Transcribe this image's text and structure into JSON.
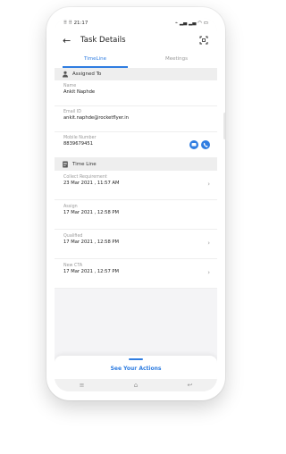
{
  "status_bar": {
    "time": "21:17",
    "left_icons": "⠿ ⠿",
    "right_icons": "⌁ ▂▄ ▂▄ ◠ ▭"
  },
  "header": {
    "title": "Task Details",
    "back_icon": "arrow-left-icon",
    "expand_icon": "expand-icon"
  },
  "tabs": [
    {
      "label": "TimeLine",
      "active": true
    },
    {
      "label": "Meetings",
      "active": false
    }
  ],
  "assigned_to": {
    "heading": "Assigned To",
    "fields": [
      {
        "label": "Name",
        "value": "Ankit Naphde"
      },
      {
        "label": "Email ID",
        "value": "ankit.naphde@rocketflyer.in"
      },
      {
        "label": "Mobile Number",
        "value": "8839679451"
      }
    ]
  },
  "timeline": {
    "heading": "Time Line",
    "items": [
      {
        "label": "Collect Requirement",
        "value": "23 Mar 2021 , 11:57 AM",
        "has_chevron": true
      },
      {
        "label": "Assign",
        "value": "17 Mar 2021 , 12:58 PM",
        "has_chevron": false
      },
      {
        "label": "Qualified",
        "value": "17 Mar 2021 , 12:58 PM",
        "has_chevron": true
      },
      {
        "label": "New CTA",
        "value": "17 Mar 2021 , 12:57 PM",
        "has_chevron": true
      }
    ]
  },
  "bottom_sheet": {
    "button_label": "See Your Actions"
  },
  "colors": {
    "accent": "#2f7de1",
    "background": "#f4f4f6"
  }
}
